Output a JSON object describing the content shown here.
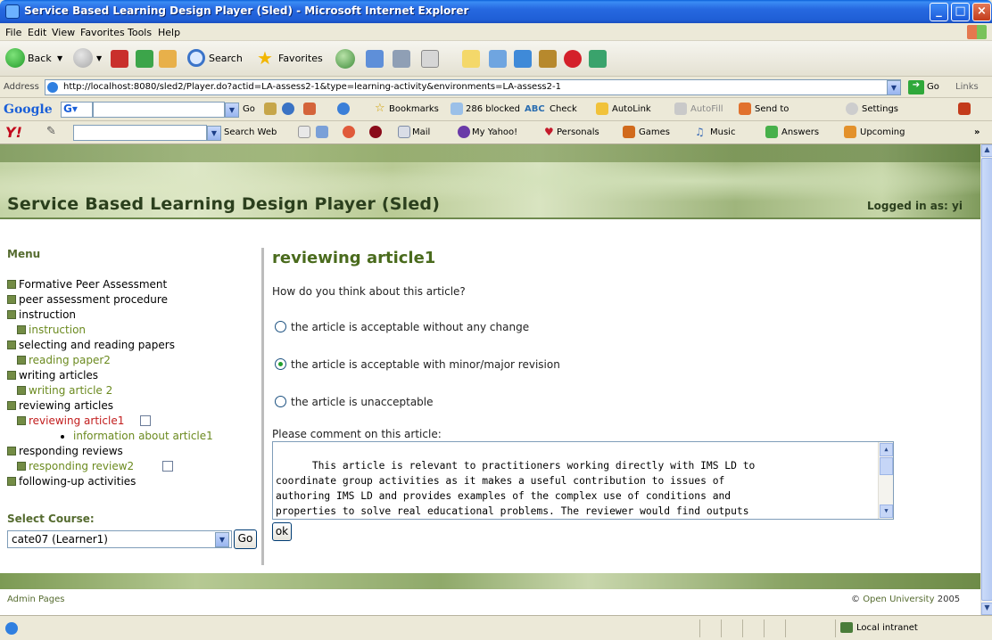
{
  "window": {
    "title": "Service Based Learning Design Player (Sled) - Microsoft Internet Explorer"
  },
  "menubar": [
    "File",
    "Edit",
    "View",
    "Favorites",
    "Tools",
    "Help"
  ],
  "toolbar": {
    "back": "Back",
    "search": "Search",
    "favorites": "Favorites"
  },
  "addressbar": {
    "label": "Address",
    "url": "http://localhost:8080/sled2/Player.do?actid=LA-assess2-1&type=learning-activity&environments=LA-assess2-1",
    "go": "Go",
    "links": "Links"
  },
  "googlebar": {
    "brand": "Google",
    "go": "Go",
    "bookmarks": "Bookmarks",
    "blocked": "286 blocked",
    "check": "Check",
    "autolink": "AutoLink",
    "autofill": "AutoFill",
    "sendto": "Send to",
    "settings": "Settings"
  },
  "yahoobar": {
    "brand": "Y!",
    "searchweb": "Search Web",
    "mail": "Mail",
    "myyahoo": "My Yahoo!",
    "personals": "Personals",
    "games": "Games",
    "music": "Music",
    "answers": "Answers",
    "upcoming": "Upcoming"
  },
  "page": {
    "site_title": "Service Based Learning Design Player (Sled)",
    "logged_in": "Logged in as: yi"
  },
  "sidebar": {
    "heading": "Menu",
    "items": [
      {
        "label": "Formative Peer Assessment"
      },
      {
        "label": "peer assessment procedure"
      },
      {
        "label": "instruction"
      },
      {
        "label": "instruction"
      },
      {
        "label": "selecting and reading papers"
      },
      {
        "label": "reading paper2"
      },
      {
        "label": "writing articles"
      },
      {
        "label": "writing article 2"
      },
      {
        "label": "reviewing articles"
      },
      {
        "label": "reviewing article1"
      },
      {
        "label": "information about article1"
      },
      {
        "label": "responding reviews"
      },
      {
        "label": "responding review2"
      },
      {
        "label": "following-up activities"
      }
    ],
    "select_heading": "Select Course:",
    "course": "cate07 (Learner1)",
    "go": "Go"
  },
  "main": {
    "title": "reviewing article1",
    "question": "How do you think about this article?",
    "options": [
      {
        "label": "the article is acceptable without any change",
        "selected": false
      },
      {
        "label": "the article is acceptable with minor/major revision",
        "selected": true
      },
      {
        "label": "the article is unacceptable",
        "selected": false
      }
    ],
    "comment_label": "Please comment on this article:",
    "comment": "This article is relevant to practitioners working directly with IMS LD to\ncoordinate group activities as it makes a useful contribution to issues of\nauthoring IMS LD and provides examples of the complex use of conditions and\nproperties to solve real educational problems. The reviewer would find outputs\nfrom this research useful. Some suggestions on how the article can be improved",
    "ok": "ok"
  },
  "footer": {
    "admin": "Admin Pages",
    "copyright_prefix": "©",
    "owner": "Open University",
    "year": "2005"
  },
  "statusbar": {
    "zone": "Local intranet"
  },
  "colors": {
    "title_bar": "#2668e0",
    "heading_green": "#4a6b1d",
    "link_green": "#6b8a1f",
    "active_red": "#c21d1d"
  }
}
